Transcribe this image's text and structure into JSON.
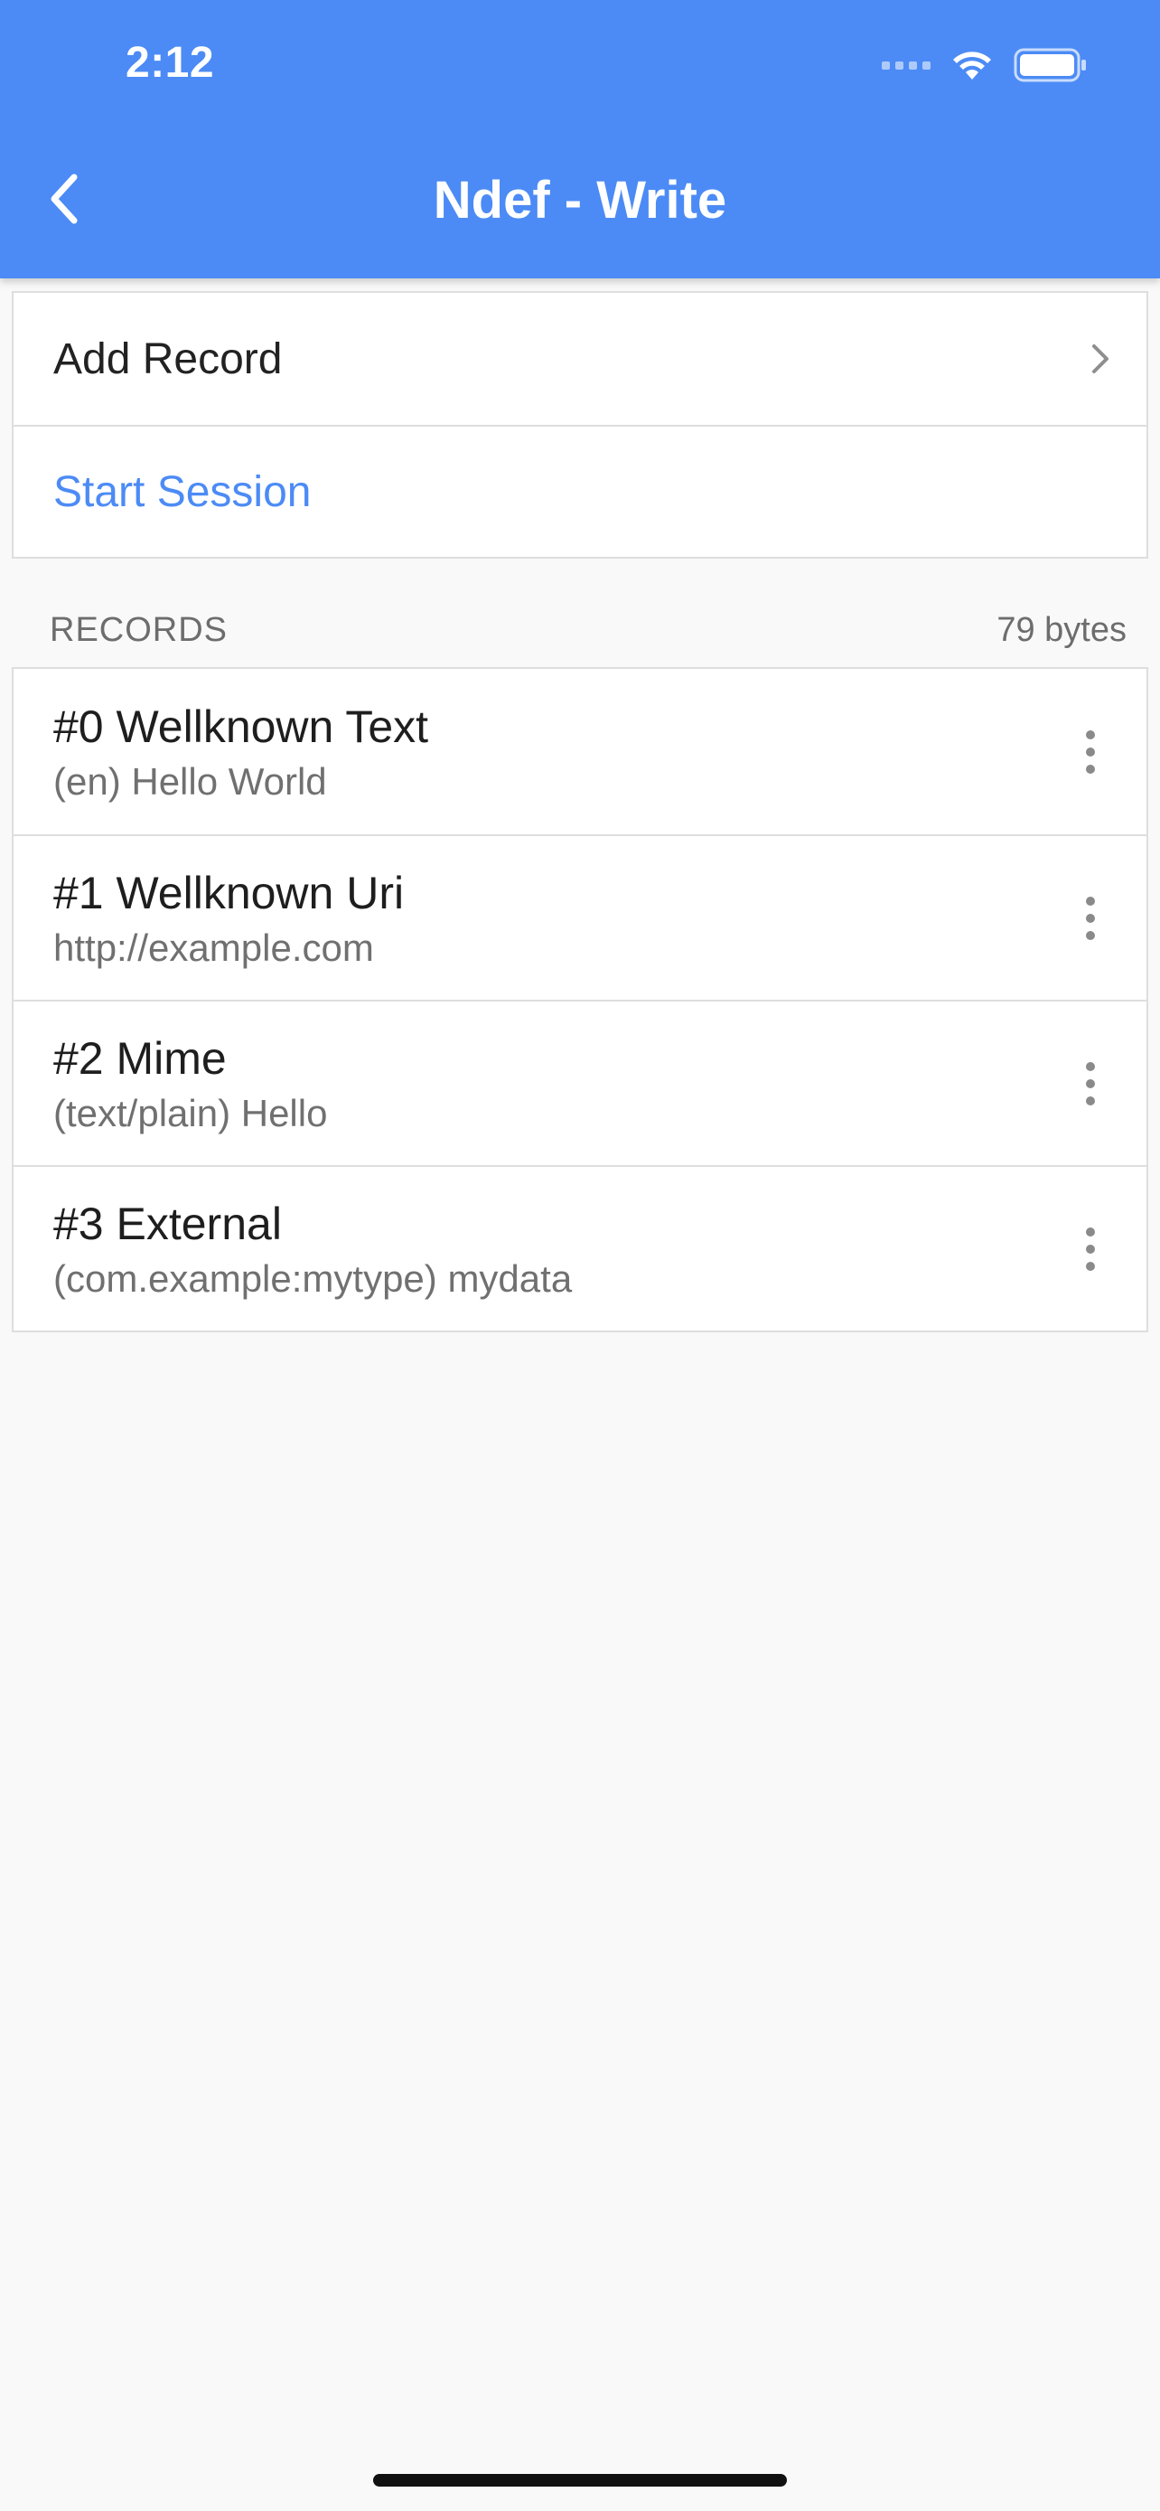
{
  "status_bar": {
    "time": "2:12"
  },
  "app_bar": {
    "title": "Ndef - Write"
  },
  "actions": {
    "add_record": "Add Record",
    "start_session": "Start Session"
  },
  "records_section": {
    "title": "RECORDS",
    "size": "79 bytes",
    "items": [
      {
        "title": "#0 Wellknown Text",
        "subtitle": "(en) Hello World"
      },
      {
        "title": "#1 Wellknown Uri",
        "subtitle": "http://example.com"
      },
      {
        "title": "#2 Mime",
        "subtitle": "(text/plain) Hello"
      },
      {
        "title": "#3 External",
        "subtitle": "(com.example:mytype) mydata"
      }
    ]
  },
  "colors": {
    "accent": "#4c8bf5",
    "background": "#f9f9f9"
  }
}
